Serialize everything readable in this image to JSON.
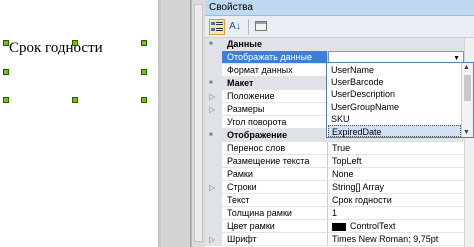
{
  "canvas": {
    "label": "Срок годности"
  },
  "panel": {
    "title": "Свойства"
  },
  "toolbar": {
    "categorized_icon": "categorized-icon",
    "alphabetical_label": "A↓",
    "pages_icon": "property-pages-icon"
  },
  "rows": [
    {
      "type": "cat",
      "name": "Данные"
    },
    {
      "type": "prop",
      "name": "Отображать данные",
      "value": "",
      "selected": true,
      "dropdown": true
    },
    {
      "type": "prop",
      "name": "Формат данных",
      "value": ""
    },
    {
      "type": "cat",
      "name": "Макет"
    },
    {
      "type": "prop",
      "name": "Положение",
      "value": "",
      "expandable": true
    },
    {
      "type": "prop",
      "name": "Размеры",
      "value": "",
      "expandable": true
    },
    {
      "type": "prop",
      "name": "Угол поворота",
      "value": ""
    },
    {
      "type": "cat",
      "name": "Отображение"
    },
    {
      "type": "prop",
      "name": "Перенос слов",
      "value": "True"
    },
    {
      "type": "prop",
      "name": "Размещение текста",
      "value": "TopLeft"
    },
    {
      "type": "prop",
      "name": "Рамки",
      "value": "None"
    },
    {
      "type": "prop",
      "name": "Строки",
      "value": "String[] Array",
      "expandable": true
    },
    {
      "type": "prop",
      "name": "Текст",
      "value": "Срок годности"
    },
    {
      "type": "prop",
      "name": "Толщина рамки",
      "value": "1"
    },
    {
      "type": "prop",
      "name": "Цвет рамки",
      "value": "ControlText",
      "swatch": "#000000"
    },
    {
      "type": "prop",
      "name": "Шрифт",
      "value": "Times New Roman; 9,75pt",
      "expandable": true
    }
  ],
  "dropdown": {
    "items": [
      "UserName",
      "UserBarcode",
      "UserDescription",
      "UserGroupName",
      "SKU",
      "ExpiredDate"
    ],
    "selected": "ExpiredDate"
  },
  "colors": {
    "selection": "#3d7fd6",
    "title_bar": "#bfd9f2",
    "handle": "#7fbf00"
  }
}
